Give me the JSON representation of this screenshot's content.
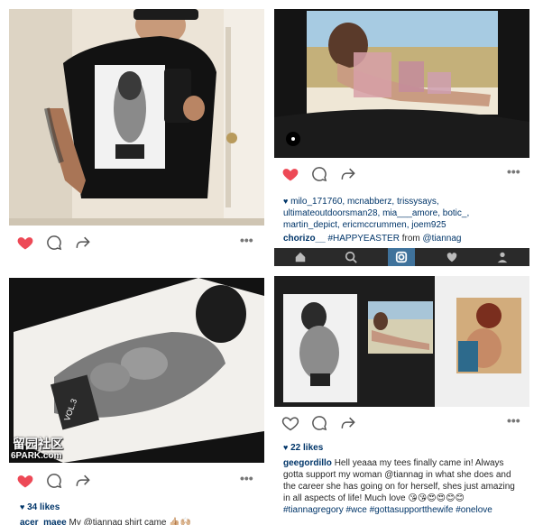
{
  "posts": [
    {
      "image_description": "",
      "has_like": true
    },
    {
      "liked": true,
      "likers": "milo_171760, mcnabberz, trissysays, ultimateoutdoorsman28, mia___amore, botic_, martin_depict, ericmccrummen, joem925",
      "comment_user": "chorizo__",
      "comment_hashtag": "#HAPPYEASTER",
      "comment_from": "from",
      "comment_mention": "@tiannag"
    },
    {
      "watermark_cn": "留园社区",
      "watermark_url": "6PARK.com",
      "likes": "34 likes",
      "caption_user": "acer_maee",
      "caption_text": "My @tiannag shirt came 👍🏼🙌🏼"
    },
    {
      "likes": "22 likes",
      "caption_user": "geegordillo",
      "caption_text": "Hell yeaaa my tees finally came in! Always gotta support my woman @tiannag in what she does and the career she has going on for herself, shes just amazing in all aspects of life! Much love 😘😘😍😍😊😊",
      "caption_tags": "#gottasupportthewife #onelove",
      "caption_tag_prefix": "#tiannagregory #wce"
    }
  ],
  "more_label": "•••",
  "colors": {
    "like_red": "#ed4956",
    "link_blue": "#003569"
  }
}
